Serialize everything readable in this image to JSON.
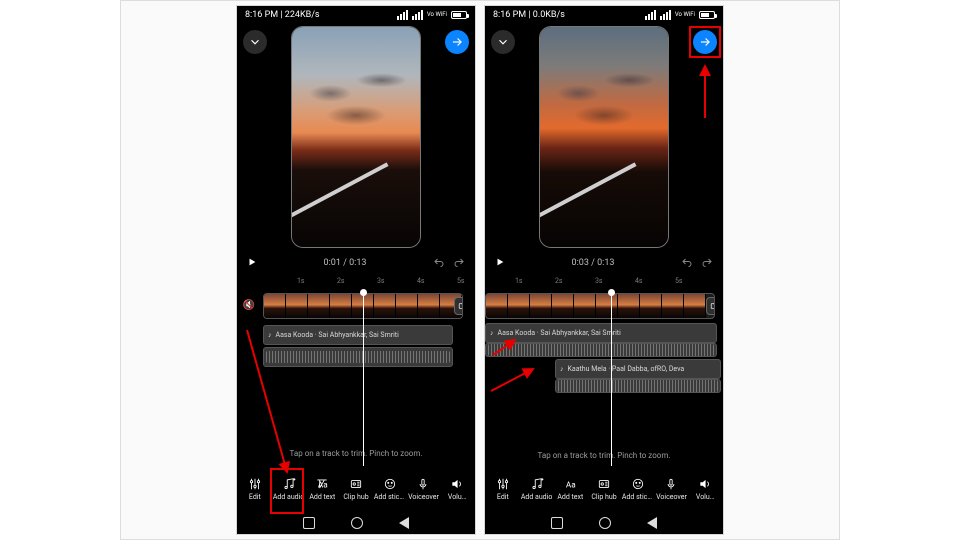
{
  "status": {
    "leftA": "8:16 PM | 224KB/s",
    "leftB": "8:16 PM | 0.0KB/s",
    "wifiLabel": "Vo\nWiFi"
  },
  "playback": {
    "timeA": "0:01 / 0:13",
    "timeB": "0:03 / 0:13"
  },
  "ruler": {
    "marks": [
      "1s",
      "2s",
      "3s",
      "4s",
      "5s"
    ]
  },
  "audio": {
    "track1": "Aasa Kooda · Sai Abhyankkar, Sai Smriti",
    "track2": "Kaathu Mela · Paal Dabba, ofRO, Deva"
  },
  "hint": "Tap on a track to trim. Pinch to zoom.",
  "tools": [
    {
      "id": "edit",
      "label": "Edit"
    },
    {
      "id": "add-audio",
      "label": "Add audio"
    },
    {
      "id": "add-text",
      "label": "Add text"
    },
    {
      "id": "clip-hub",
      "label": "Clip hub"
    },
    {
      "id": "add-stickers",
      "label": "Add stick…"
    },
    {
      "id": "voiceover",
      "label": "Voiceover"
    },
    {
      "id": "volume",
      "label": "Volu…"
    }
  ]
}
